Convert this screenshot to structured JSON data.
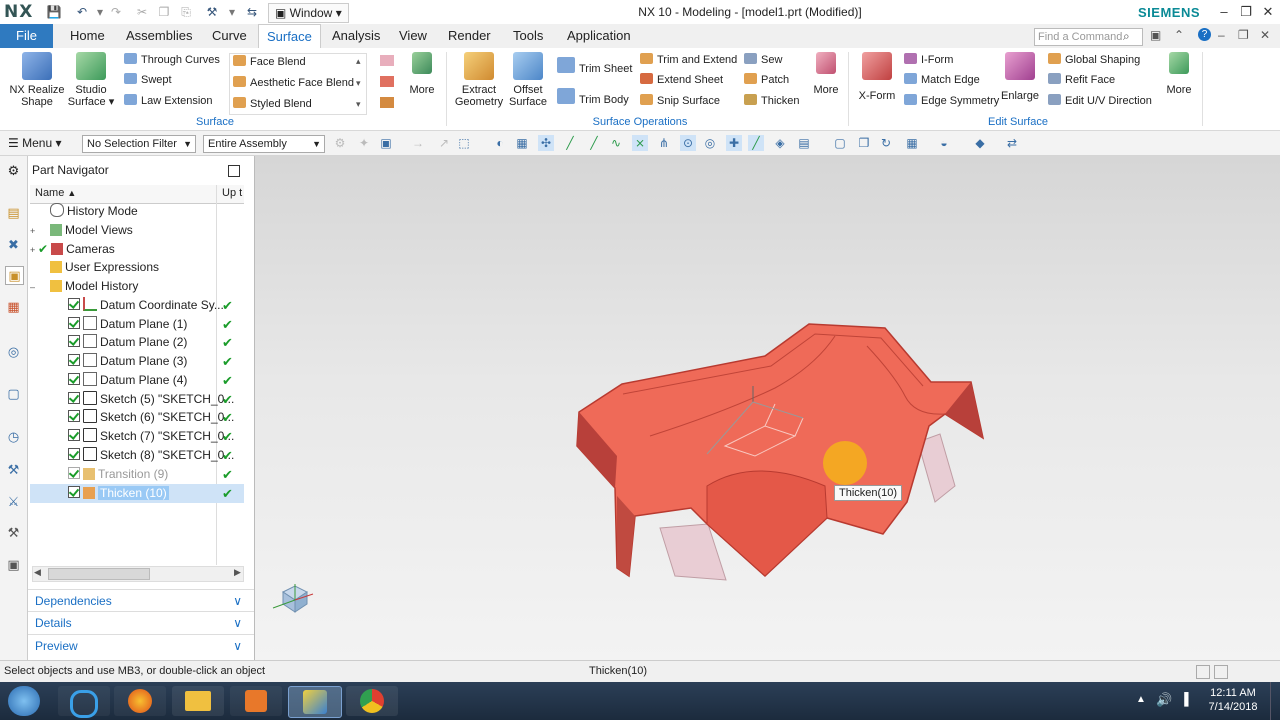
{
  "titlebar": {
    "logo": "NX",
    "window_menu": "Window",
    "title": "NX 10 - Modeling - [model1.prt (Modified)]",
    "brand": "SIEMENS"
  },
  "menubar": {
    "file": "File",
    "tabs": [
      "Home",
      "Assemblies",
      "Curve",
      "Surface",
      "Analysis",
      "View",
      "Render",
      "Tools",
      "Application"
    ],
    "active_tab": "Surface",
    "find_placeholder": "Find a Command"
  },
  "ribbon": {
    "surface_group": {
      "label": "Surface",
      "big": [
        "NX Realize Shape",
        "Studio Surface"
      ],
      "small_col1": [
        "Through Curves",
        "Swept",
        "Law Extension"
      ],
      "small_col2": [
        "Face Blend",
        "Aesthetic Face Blend",
        "Styled Blend"
      ],
      "more": "More"
    },
    "surface_ops_group": {
      "label": "Surface Operations",
      "big": [
        "Extract Geometry",
        "Offset Surface"
      ],
      "small_col1": [
        "Trim Sheet",
        "Trim Body"
      ],
      "small_col2": [
        "Trim and Extend",
        "Extend Sheet",
        "Snip Surface"
      ],
      "small_col3": [
        "Sew",
        "Patch",
        "Thicken"
      ],
      "more": "More"
    },
    "edit_surface_group": {
      "label": "Edit Surface",
      "big": [
        "X-Form",
        "Enlarge"
      ],
      "small_col1": [
        "I-Form",
        "Match Edge",
        "Edge Symmetry"
      ],
      "small_col2": [
        "Global Shaping",
        "Refit Face",
        "Edit U/V Direction"
      ],
      "more": "More"
    }
  },
  "toolbar": {
    "menu": "Menu",
    "selection_filter": "No Selection Filter",
    "scope": "Entire Assembly"
  },
  "navigator": {
    "title": "Part Navigator",
    "col_name": "Name",
    "col_up": "Up t",
    "rows": [
      {
        "label": "History Mode",
        "indent": 0
      },
      {
        "label": "Model Views",
        "indent": 0
      },
      {
        "label": "Cameras",
        "indent": 0
      },
      {
        "label": "User Expressions",
        "indent": 0
      },
      {
        "label": "Model History",
        "indent": 0
      },
      {
        "label": "Datum Coordinate Sy...",
        "indent": 1
      },
      {
        "label": "Datum Plane (1)",
        "indent": 1
      },
      {
        "label": "Datum Plane (2)",
        "indent": 1
      },
      {
        "label": "Datum Plane (3)",
        "indent": 1
      },
      {
        "label": "Datum Plane (4)",
        "indent": 1
      },
      {
        "label": "Sketch (5) \"SKETCH_0...",
        "indent": 1
      },
      {
        "label": "Sketch (6) \"SKETCH_0...",
        "indent": 1
      },
      {
        "label": "Sketch (7) \"SKETCH_0...",
        "indent": 1
      },
      {
        "label": "Sketch (8) \"SKETCH_0...",
        "indent": 1
      },
      {
        "label": "Transition (9)",
        "indent": 1
      },
      {
        "label": "Thicken (10)",
        "indent": 1
      }
    ],
    "panels": [
      "Dependencies",
      "Details",
      "Preview"
    ]
  },
  "viewport": {
    "tooltip": "Thicken(10)",
    "body_color": "#ef6a58"
  },
  "status": {
    "message": "Select objects and use MB3, or double-click an object",
    "selection": "Thicken(10)"
  },
  "taskbar": {
    "time": "12:11 AM",
    "date": "7/14/2018"
  }
}
